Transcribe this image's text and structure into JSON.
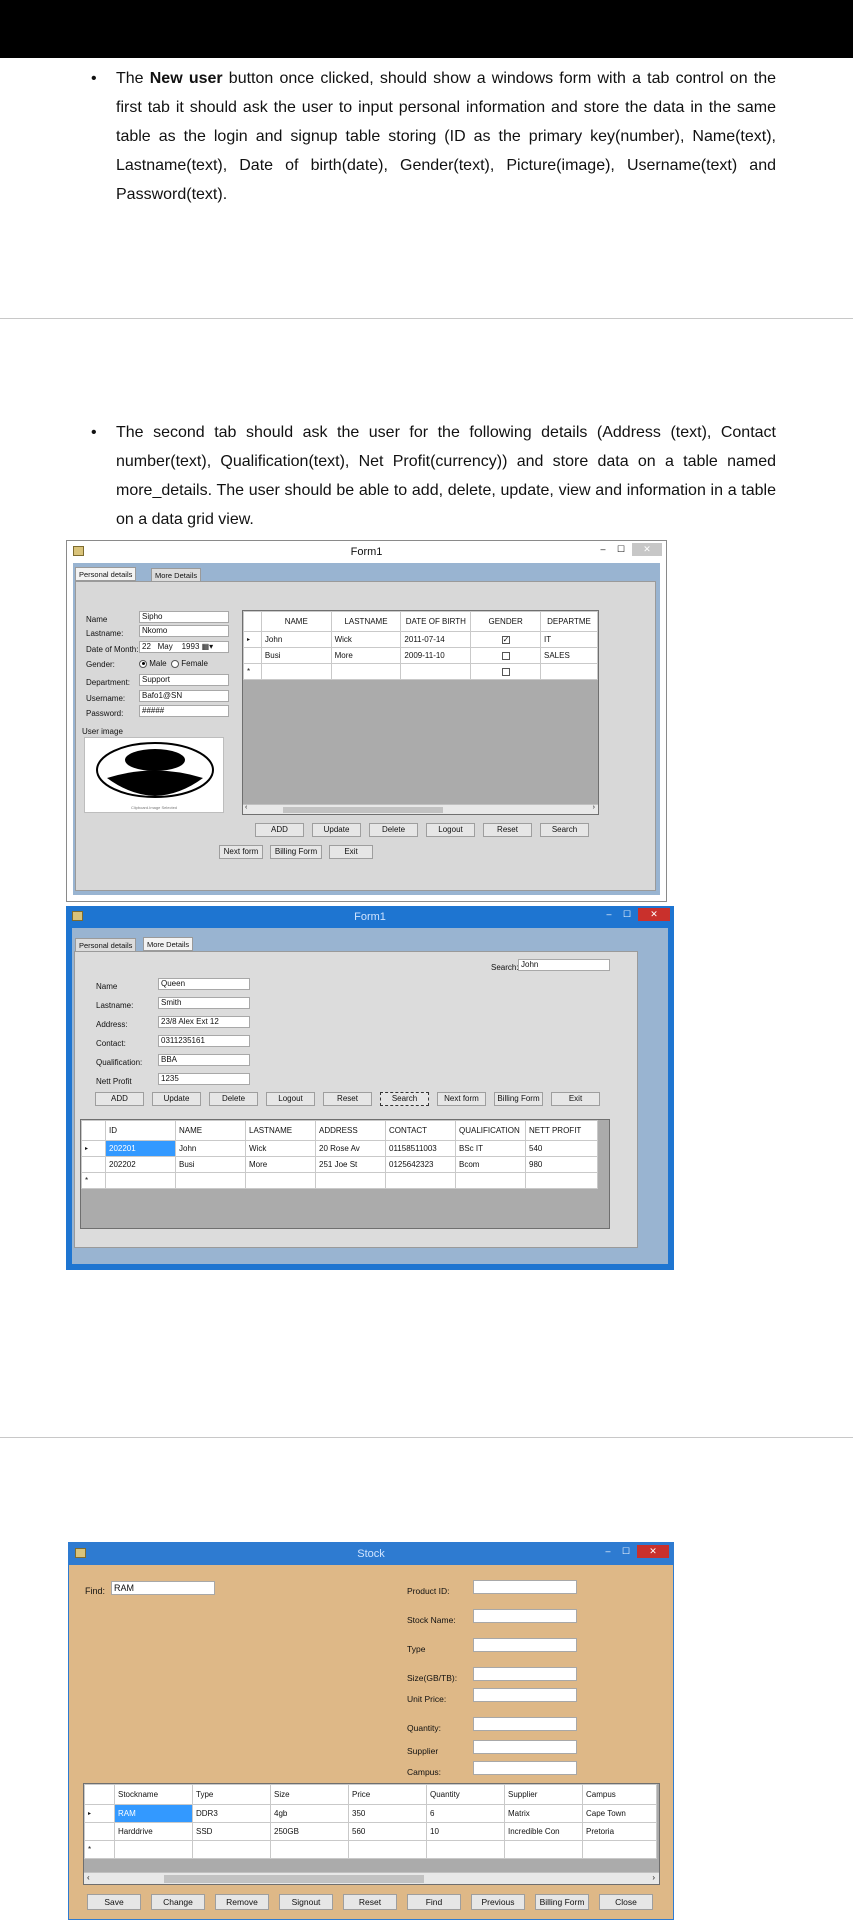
{
  "paragraph1": {
    "prefix": "The ",
    "bold": "New user",
    "text": " button once clicked, should show a windows form with a tab control on the first tab it should ask the user to input personal information and store the data in the same table as the login and signup table storing (ID as the primary key(number), Name(text), Lastname(text), Date of birth(date), Gender(text), Picture(image), Username(text) and Password(text)."
  },
  "paragraph2": {
    "text": "The second tab should ask the user for the following details (Address (text), Contact number(text), Qualification(text), Net Profit(currency)) and store data on a table  named more_details. The user should be able to add, delete, update, view and information in a table on a data grid view."
  },
  "form1a": {
    "title": "Form1",
    "tabs": [
      "Personal details",
      "More Details"
    ],
    "labels": {
      "name": "Name",
      "lastname": "Lastname:",
      "dob": "Date of Month:",
      "gender": "Gender:",
      "department": "Department:",
      "username": "Username:",
      "password": "Password:",
      "user_image": "User image"
    },
    "values": {
      "name": "Sipho",
      "lastname": "Nkomo",
      "dob_day": "22",
      "dob_month": "May",
      "dob_year": "1993",
      "gender_male": "Male",
      "gender_female": "Female",
      "department": "Support",
      "username": "Bafo1@SN",
      "password": "#####"
    },
    "image_caption": "Clipboard.Image Selected",
    "grid_headers": [
      "NAME",
      "LASTNAME",
      "DATE OF BIRTH",
      "GENDER",
      "DEPARTME"
    ],
    "grid_rows": [
      [
        "John",
        "Wick",
        "2011-07-14",
        "",
        "IT"
      ],
      [
        "Busi",
        "More",
        "2009-11-10",
        "",
        "SALES"
      ]
    ],
    "row_buttons": [
      "ADD",
      "Update",
      "Delete",
      "Logout",
      "Reset",
      "Search"
    ],
    "bottom_buttons": [
      "Next form",
      "Billing Form",
      "Exit"
    ]
  },
  "form1b": {
    "title": "Form1",
    "tabs": [
      "Personal details",
      "More Details"
    ],
    "search_label": "Search:",
    "search_value": "John",
    "labels": {
      "name": "Name",
      "lastname": "Lastname:",
      "address": "Address:",
      "contact": "Contact:",
      "qualification": "Qualification:",
      "netprofit": "Nett Profit"
    },
    "values": {
      "name": "Queen",
      "lastname": "Smith",
      "address": "23/8 Alex Ext 12",
      "contact": "0311235161",
      "qualification": "BBA",
      "netprofit": "1235"
    },
    "buttons": [
      "ADD",
      "Update",
      "Delete",
      "Logout",
      "Reset",
      "Search",
      "Next form",
      "Billing Form",
      "Exit"
    ],
    "grid_headers": [
      "ID",
      "NAME",
      "LASTNAME",
      "ADDRESS",
      "CONTACT",
      "QUALIFICATION",
      "NETT PROFIT"
    ],
    "grid_rows": [
      [
        "202201",
        "John",
        "Wick",
        "20 Rose Av",
        "01158511003",
        "BSc IT",
        "540"
      ],
      [
        "202202",
        "Busi",
        "More",
        "251 Joe St",
        "0125642323",
        "Bcom",
        "980"
      ]
    ]
  },
  "stock": {
    "title": "Stock",
    "find_label": "Find:",
    "find_value": "RAM",
    "fields": [
      "Product ID:",
      "Stock Name:",
      "Type",
      "Size(GB/TB):",
      "Unit Price:",
      "Quantity:",
      "Supplier",
      "Campus:"
    ],
    "grid_headers": [
      "Stockname",
      "Type",
      "Size",
      "Price",
      "Quantity",
      "Supplier",
      "Campus"
    ],
    "grid_rows": [
      [
        "RAM",
        "DDR3",
        "4gb",
        "350",
        "6",
        "Matrix",
        "Cape Town"
      ],
      [
        "Harddrive",
        "SSD",
        "250GB",
        "560",
        "10",
        "Incredible Con",
        "Pretoria"
      ]
    ],
    "buttons": [
      "Save",
      "Change",
      "Remove",
      "Signout",
      "Reset",
      "Find",
      "Previous",
      "Billing Form",
      "Close"
    ]
  },
  "colors": {
    "form1a_frame": "#99b4d1",
    "form1b_title": "#1e75d1",
    "stock_body": "#deb887",
    "stock_title": "#2e7bd1",
    "selection": "#3399ff"
  }
}
